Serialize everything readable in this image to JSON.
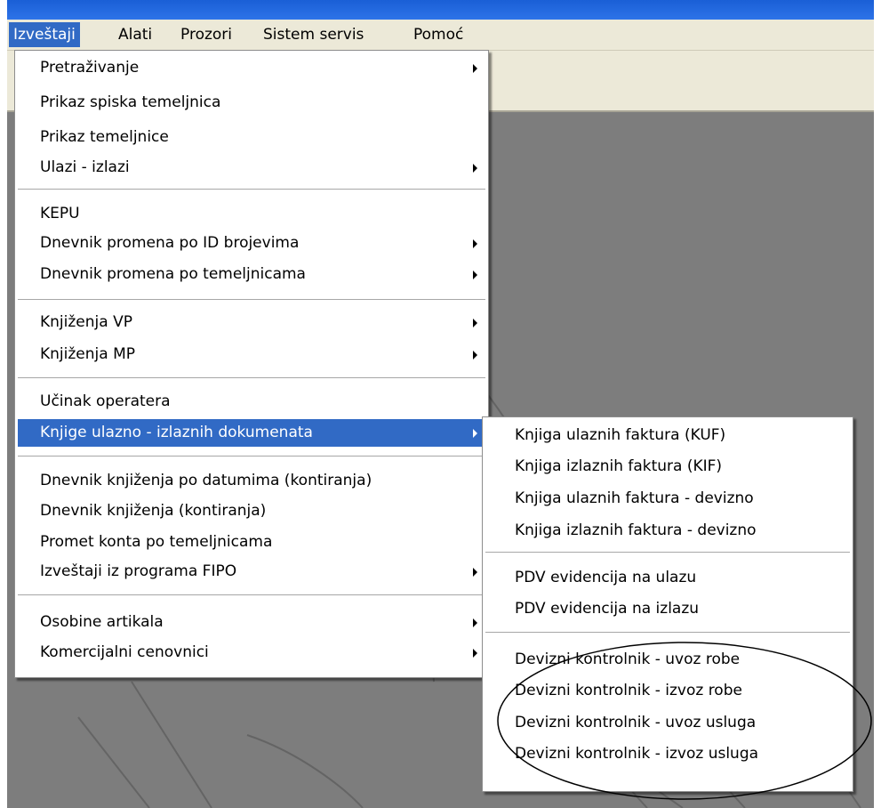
{
  "menubar": {
    "items": [
      "Izveštaji",
      "Alati",
      "Prozori",
      "Sistem servis",
      "Pomoć"
    ]
  },
  "main_menu": {
    "items": [
      {
        "label": "Pretraživanje",
        "submenu": true
      },
      {
        "label": "Prikaz spiska temeljnica",
        "submenu": false
      },
      {
        "label": "Prikaz temeljnice",
        "submenu": false
      },
      {
        "label": "Ulazi - izlazi",
        "submenu": true
      },
      {
        "label": "KEPU",
        "submenu": false
      },
      {
        "label": "Dnevnik promena po ID brojevima",
        "submenu": true
      },
      {
        "label": "Dnevnik promena po temeljnicama",
        "submenu": true
      },
      {
        "label": "Knjiženja VP",
        "submenu": true
      },
      {
        "label": "Knjiženja MP",
        "submenu": true
      },
      {
        "label": "Učinak operatera",
        "submenu": false
      },
      {
        "label": "Knjige ulazno - izlaznih dokumenata",
        "submenu": true,
        "highlighted": true
      },
      {
        "label": "Dnevnik knjiženja po datumima (kontiranja)",
        "submenu": false
      },
      {
        "label": "Dnevnik knjiženja (kontiranja)",
        "submenu": false
      },
      {
        "label": "Promet konta po temeljnicama",
        "submenu": false
      },
      {
        "label": "Izveštaji iz programa FIPO",
        "submenu": true
      },
      {
        "label": "Osobine artikala",
        "submenu": true
      },
      {
        "label": "Komercijalni cenovnici",
        "submenu": true
      }
    ]
  },
  "submenu": {
    "items": [
      "Knjiga ulaznih faktura (KUF)",
      "Knjiga izlaznih faktura (KIF)",
      "Knjiga ulaznih faktura - devizno",
      "Knjiga izlaznih faktura - devizno",
      "PDV evidencija na ulazu",
      "PDV evidencija na izlazu",
      "Devizni kontrolnik - uvoz robe",
      "Devizni kontrolnik - izvoz robe",
      "Devizni kontrolnik - uvoz usluga",
      "Devizni kontrolnik - izvoz usluga"
    ]
  },
  "colors": {
    "selection": "#316ac5",
    "menubar_bg": "#ece9d8",
    "workspace_bg": "#7d7d7d"
  }
}
